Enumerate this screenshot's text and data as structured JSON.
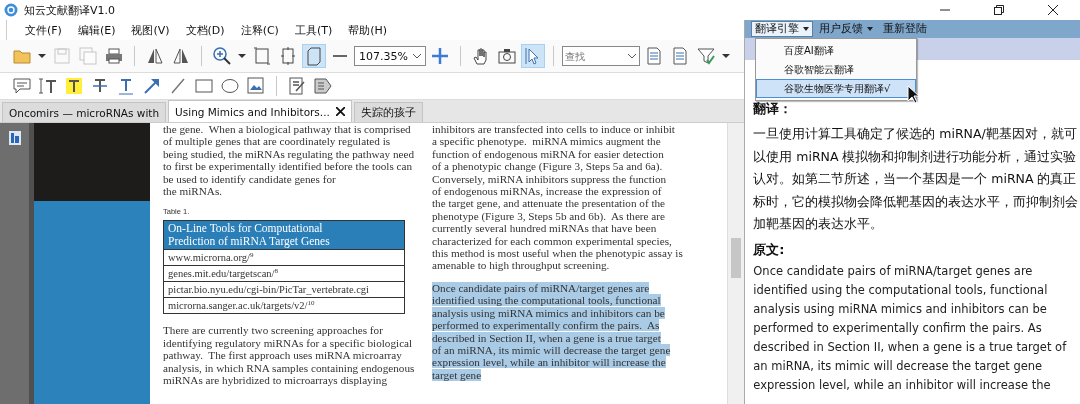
{
  "window": {
    "title": "知云文献翻译V1.0"
  },
  "menu": [
    "文件(F)",
    "编辑(E)",
    "视图(V)",
    "文档(D)",
    "注释(C)",
    "工具(T)",
    "帮助(H)"
  ],
  "toolbar": {
    "groups": [
      [
        {
          "kind": "folder",
          "selected": false,
          "disabled": false
        },
        {
          "kind": "caret",
          "selected": false,
          "disabled": false
        },
        {
          "kind": "save",
          "selected": false,
          "disabled": true
        },
        {
          "kind": "save-all",
          "selected": false,
          "disabled": true
        },
        {
          "kind": "printer",
          "selected": false,
          "disabled": false
        }
      ],
      [
        {
          "kind": "flip-left",
          "selected": false,
          "disabled": false
        },
        {
          "kind": "flip-right",
          "selected": false,
          "disabled": false
        }
      ],
      [
        {
          "kind": "zoom-in",
          "selected": false,
          "disabled": false
        },
        {
          "kind": "caret",
          "selected": false,
          "disabled": false
        },
        {
          "kind": "fit-page",
          "selected": false,
          "disabled": false
        },
        {
          "kind": "page-rotate",
          "selected": false,
          "disabled": false
        },
        {
          "kind": "page-fit",
          "selected": true,
          "disabled": false
        },
        {
          "kind": "minus",
          "selected": false,
          "disabled": false
        },
        {
          "kind": "zoom-field",
          "value": "107.35%"
        },
        {
          "kind": "plus",
          "selected": false,
          "disabled": false
        }
      ],
      [
        {
          "kind": "hand",
          "selected": false,
          "disabled": false
        },
        {
          "kind": "camera",
          "selected": false,
          "disabled": false
        },
        {
          "kind": "select",
          "selected": true,
          "disabled": false
        }
      ],
      [
        {
          "kind": "search-field",
          "placeholder": "查找"
        },
        {
          "kind": "document",
          "selected": false,
          "disabled": false
        },
        {
          "kind": "document",
          "selected": false,
          "disabled": false
        },
        {
          "kind": "filter",
          "selected": false,
          "disabled": false
        },
        {
          "kind": "caret",
          "selected": false,
          "disabled": false
        }
      ]
    ]
  },
  "annotation_toolbar": {
    "groups": [
      [
        {
          "kind": "comment"
        },
        {
          "kind": "text-box"
        },
        {
          "kind": "highlight"
        },
        {
          "kind": "strikeout"
        },
        {
          "kind": "underline"
        },
        {
          "kind": "arrow"
        },
        {
          "kind": "line"
        },
        {
          "kind": "rectangle"
        },
        {
          "kind": "ellipse"
        },
        {
          "kind": "image"
        }
      ],
      [
        {
          "kind": "edit-note"
        },
        {
          "kind": "stamp"
        }
      ]
    ]
  },
  "tabs": [
    {
      "label": "Oncomirs — microRNAs with",
      "selected": false,
      "closable": false
    },
    {
      "label": "Using Mimics and Inhibitors...",
      "selected": true,
      "closable": true
    },
    {
      "label": "失踪的孩子",
      "selected": false,
      "closable": false
    }
  ],
  "document": {
    "columns": [
      {
        "blocks": [
          {
            "kind": "paragraph",
            "selected": false,
            "lines": [
              "the gene.  When a biological pathway that is comprised",
              "of multiple genes that are coordinately regulated is",
              "being studied, the miRNAs regulating the pathway need",
              "to first be experimentally identified before the tools can",
              "be used to identify candidate genes for",
              "the miRNAs."
            ]
          },
          {
            "kind": "table",
            "caption": "Table 1.",
            "header": [
              "On-Line Tools for Computational",
              "Prediction of miRNA Target Genes"
            ],
            "rows": [
              "www.microrna.org/$^{9}$",
              "genes.mit.edu/targetscan/$^{8}$",
              "pictar.bio.nyu.edu/cgi-bin/PicTar_vertebrate.cgi",
              "microrna.sanger.ac.uk/targets/v2/$^{10}$"
            ]
          },
          {
            "kind": "paragraph",
            "selected": false,
            "lines": [
              "There are currently two screening approaches for",
              "identifying regulatory miRNAs for a specific biological",
              "pathway.  The first approach uses miRNA microarray",
              "analysis, in which RNA samples containing endogenous",
              "miRNAs are hybridized to microarrays displaying"
            ]
          }
        ]
      },
      {
        "blocks": [
          {
            "kind": "paragraph",
            "selected": false,
            "lines": [
              "inhibitors are transfected into cells to induce or inhibit",
              "a specific phenotype.  miRNA mimics augment the",
              "function of endogenous miRNA for easier detection",
              "of a phenotypic change (Figure 3, Steps 5a and 6a).",
              "Conversely, miRNA inhibitors suppress the function",
              "of endogenous miRNAs, increase the expression of",
              "the target gene, and attenuate the presentation of the",
              "phenotype (Figure 3, Steps 5b and 6b).  As there are",
              "currently several hundred miRNAs that have been",
              "characterized for each common experimental species,",
              "this method is most useful when the phenotypic assay is",
              "amenable to high throughput screening."
            ]
          },
          {
            "kind": "paragraph",
            "selected": true,
            "lines": [
              "Once candidate pairs of miRNA/target genes are",
              "identified using the computational tools, functional",
              "analysis using miRNA mimics and inhibitors can be",
              "performed to experimentally confirm the pairs.  As",
              "described in Section II, when a gene is a true target",
              "of an miRNA, its mimic will decrease the target gene",
              "expression level, while an inhibitor will increase the",
              "target gene"
            ]
          }
        ]
      }
    ]
  },
  "translation_panel": {
    "menu": [
      {
        "label": "翻译引擎",
        "dropdown": true,
        "selected": true
      },
      {
        "label": "用户反馈",
        "dropdown": true,
        "selected": false
      },
      {
        "label": "重新登陆",
        "dropdown": false,
        "selected": false
      }
    ],
    "dropdown_items": [
      {
        "label": "百度AI翻译",
        "selected": false
      },
      {
        "label": "谷歌智能云翻译",
        "selected": false
      },
      {
        "label": "谷歌生物医学专用翻译√",
        "selected": true
      }
    ],
    "translation_heading": "翻译：",
    "translation_lines": [
      "一旦使用计算工具确定了候选的 miRNA/靶基因对，就可",
      "以使用 miRNA 模拟物和抑制剂进行功能分析，通过实验",
      "认对。如第二节所述，当一个基因是一个 miRNA 的真正",
      "标时，它的模拟物会降低靶基因的表达水平，而抑制剂会",
      "加靶基因的表达水平。"
    ],
    "original_heading": "原文:",
    "original_lines": [
      "Once candidate pairs of miRNA/target genes are",
      "identified using the computational tools, functional",
      "analysis using miRNA mimics and inhibitors can be",
      "performed to experimentally confirm the pairs. As",
      "described in Section II, when a gene is a true target of",
      "an miRNA, its mimic will decrease the target gene",
      "expression level, while an inhibitor will increase the"
    ]
  }
}
